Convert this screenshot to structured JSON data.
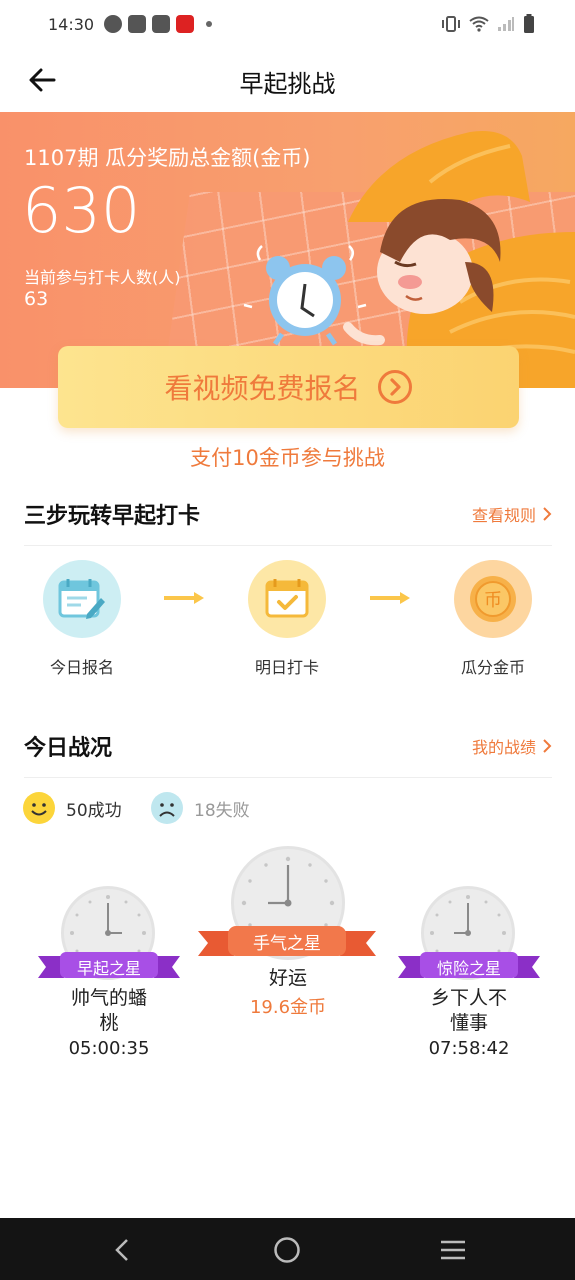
{
  "status_bar": {
    "time": "14:30"
  },
  "title_bar": {
    "title": "早起挑战"
  },
  "banner": {
    "period_title": "1107期 瓜分奖励总金额(金币)",
    "total_amount": "630",
    "participants_label": "当前参与打卡人数(人)",
    "participants_count": "63"
  },
  "signup": {
    "video_button_label": "看视频免费报名",
    "pay_link": "支付10金币参与挑战"
  },
  "steps_section": {
    "title": "三步玩转早起打卡",
    "link": "查看规则",
    "steps": [
      {
        "label": "今日报名",
        "icon": "calendar-edit-icon",
        "color": "#cdeef3"
      },
      {
        "label": "明日打卡",
        "icon": "calendar-check-icon",
        "color": "#fde7a6"
      },
      {
        "label": "瓜分金币",
        "icon": "coin-icon",
        "color": "#fdd6a0"
      }
    ]
  },
  "today_section": {
    "title": "今日战况",
    "link": "我的战绩",
    "success": "50成功",
    "failure": "18失败",
    "stars": [
      {
        "badge": "早起之星",
        "name": "帅气的蟠\n桃",
        "time": "05:00:35"
      },
      {
        "badge": "手气之星",
        "name": "好运",
        "coins": "19.6金币"
      },
      {
        "badge": "惊险之星",
        "name": "乡下人不\n懂事",
        "time": "07:58:42"
      }
    ]
  },
  "colors": {
    "accent": "#ef7a3c",
    "banner": "#f9916a",
    "purple_ribbon": "#a246e0",
    "orange_ribbon": "#f2784b"
  }
}
